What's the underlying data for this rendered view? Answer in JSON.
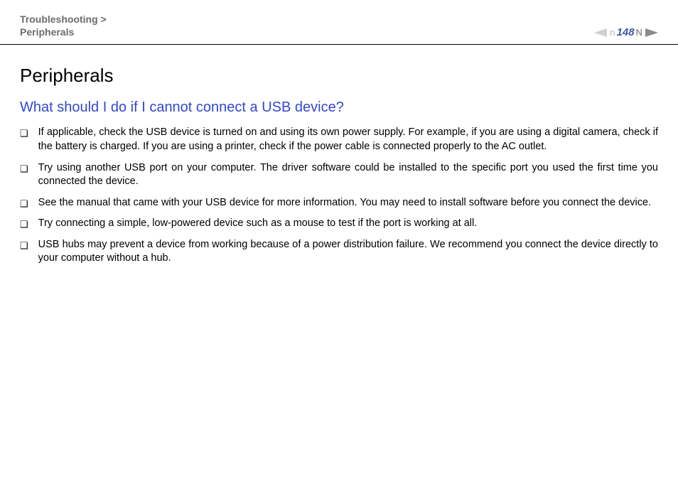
{
  "header": {
    "breadcrumb_parent": "Troubleshooting >",
    "breadcrumb_current": "Peripherals",
    "page_number": "148"
  },
  "content": {
    "title": "Peripherals",
    "section_heading": "What should I do if I cannot connect a USB device?",
    "bullets": [
      "If applicable, check the USB device is turned on and using its own power supply. For example, if you are using a digital camera, check if the battery is charged. If you are using a printer, check if the power cable is connected properly to the AC outlet.",
      "Try using another USB port on your computer. The driver software could be installed to the specific port you used the first time you connected the device.",
      "See the manual that came with your USB device for more information. You may need to install software before you connect the device.",
      "Try connecting a simple, low-powered device such as a mouse to test if the port is working at all.",
      "USB hubs may prevent a device from working because of a power distribution failure. We recommend you connect the device directly to your computer without a hub."
    ]
  }
}
